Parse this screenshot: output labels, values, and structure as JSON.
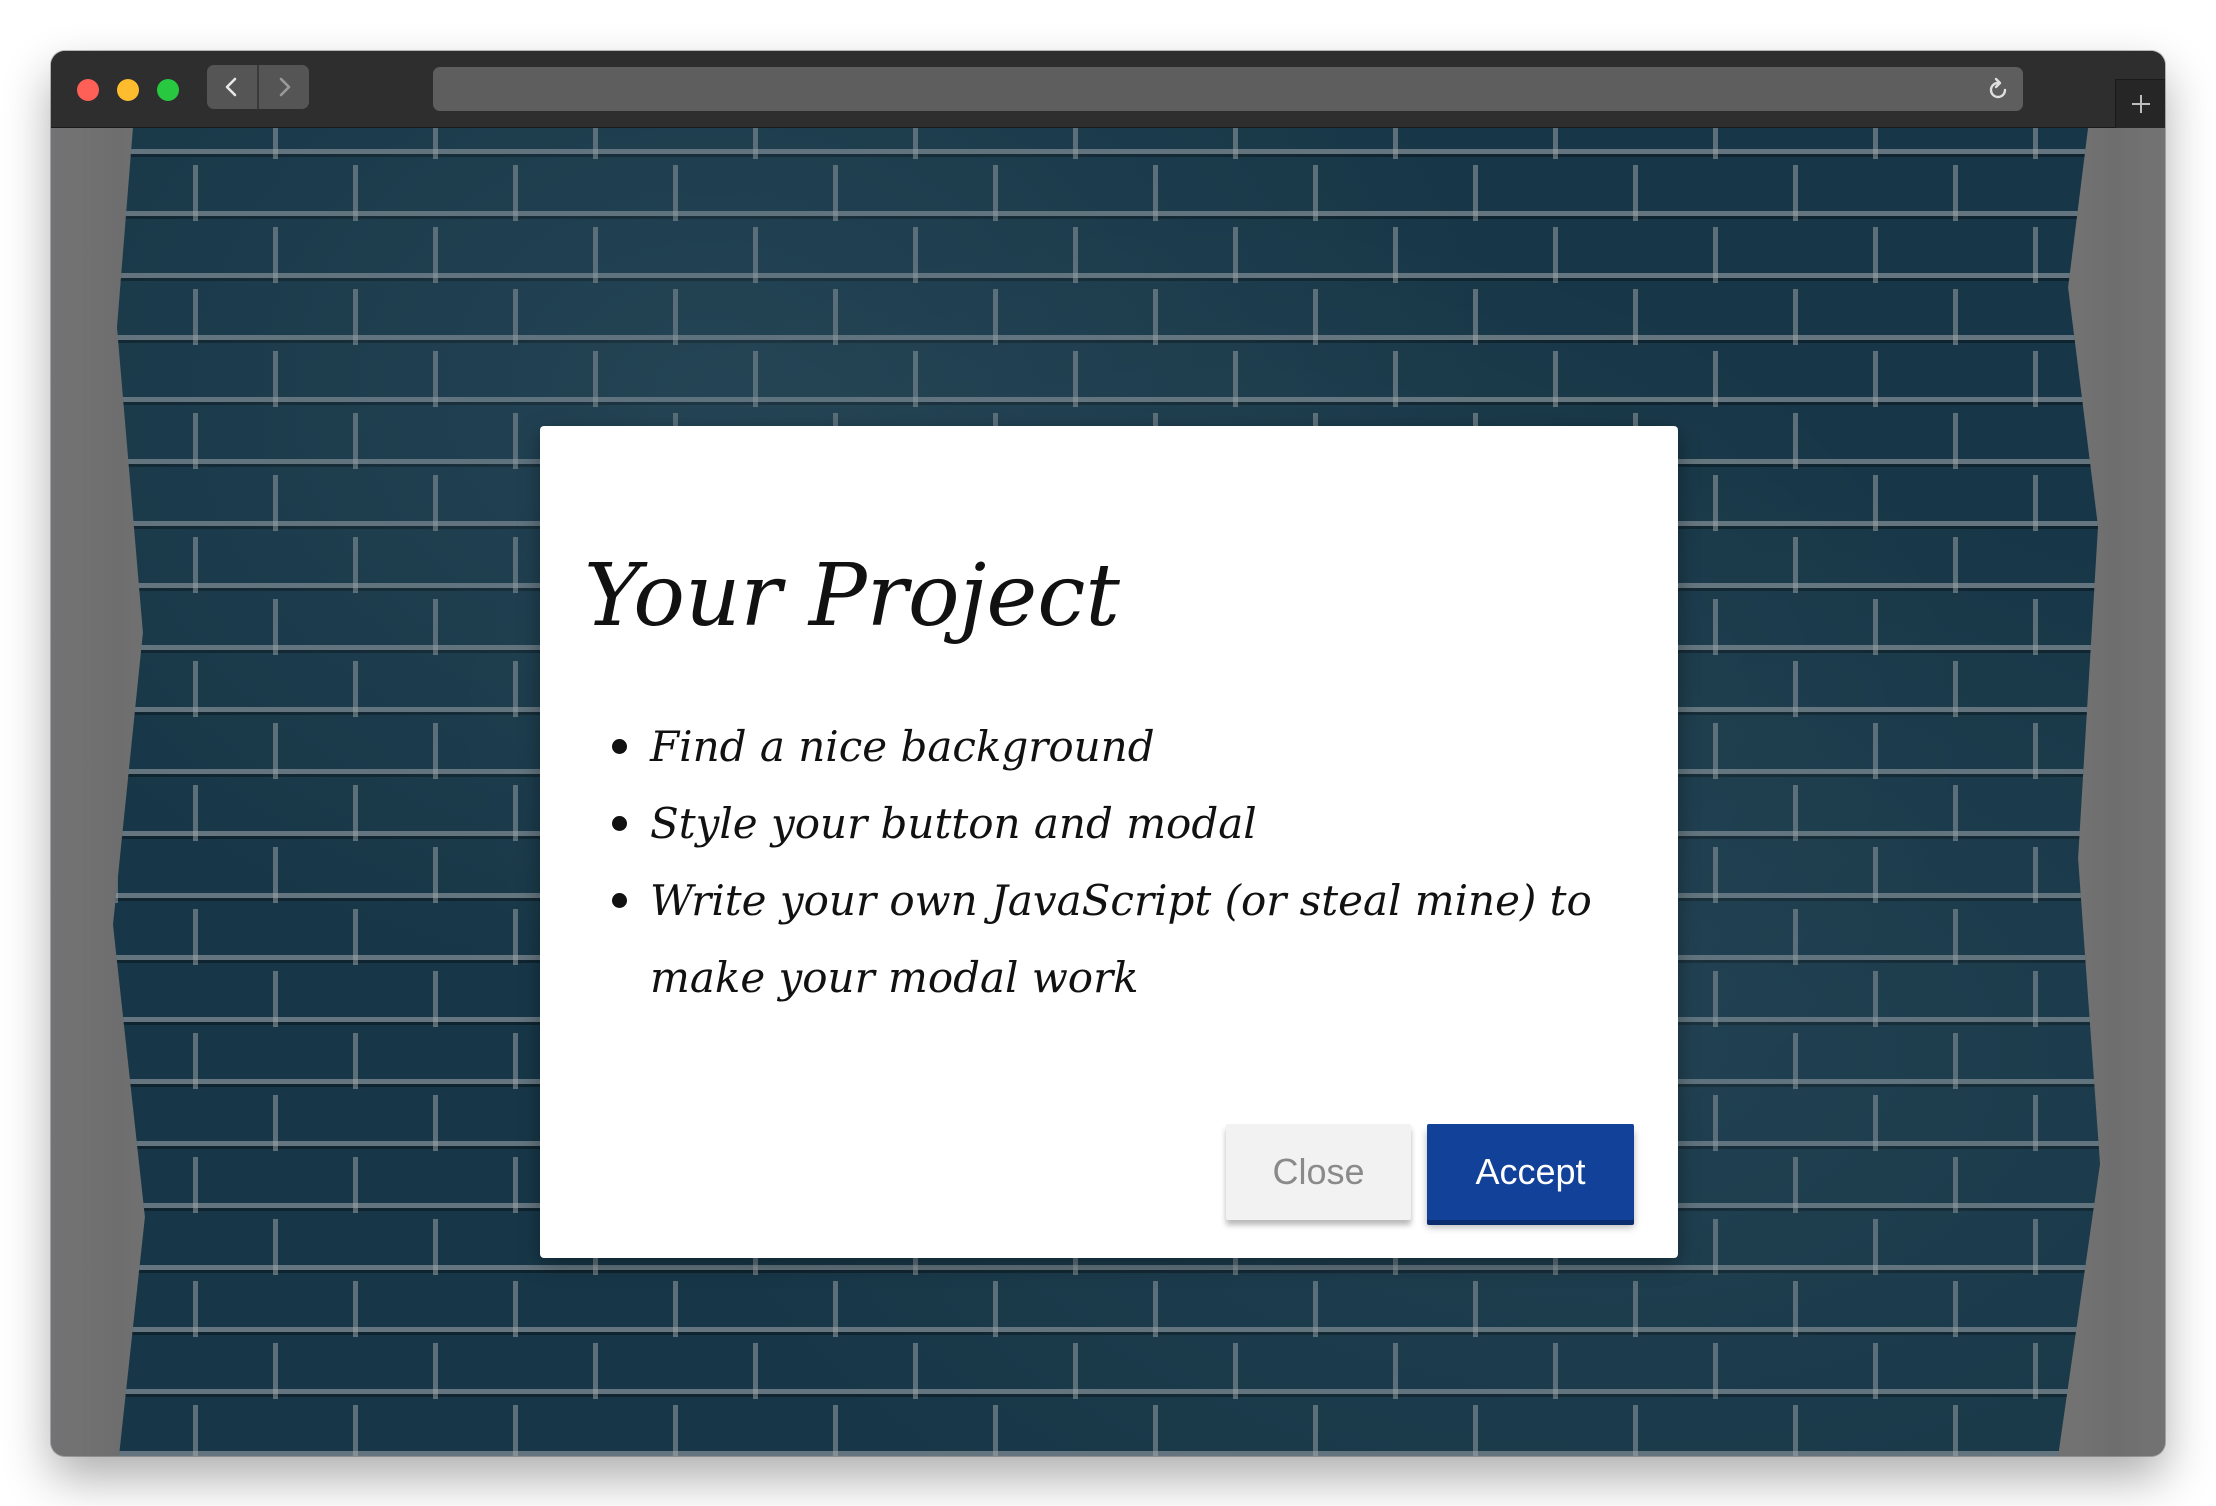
{
  "browser": {
    "address_bar": {
      "url": ""
    },
    "icons": {
      "back": "chevron-left-icon",
      "forward": "chevron-right-icon",
      "reload": "reload-icon",
      "new_tab": "plus-icon"
    }
  },
  "modal": {
    "title": "Your Project",
    "items": [
      "Find a nice background",
      "Style your button and modal",
      "Write your own JavaScript (or steal mine) to make your modal work"
    ],
    "close_label": "Close",
    "accept_label": "Accept"
  },
  "colors": {
    "accent": "#12419a",
    "close_bg": "#f2f2f2",
    "wall_paint": "#1d4458"
  }
}
